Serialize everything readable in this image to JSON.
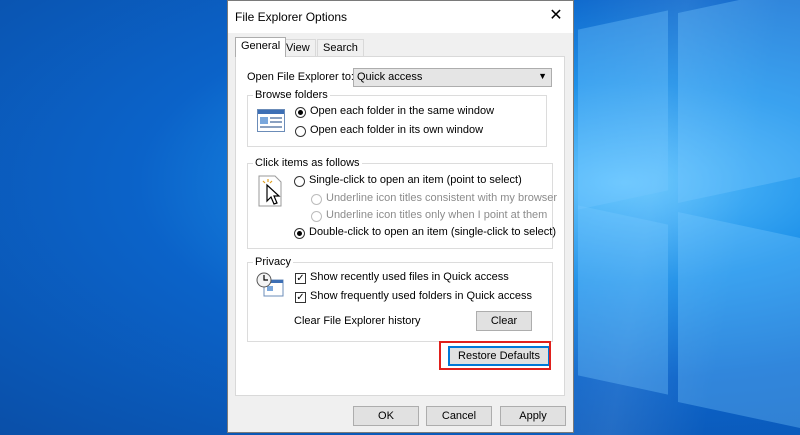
{
  "dialog": {
    "title": "File Explorer Options",
    "close_glyph": "✕"
  },
  "tabs": [
    {
      "label": "General"
    },
    {
      "label": "View"
    },
    {
      "label": "Search"
    }
  ],
  "general": {
    "open_to_label": "Open File Explorer to:",
    "open_to_value": "Quick access",
    "browse_folders": {
      "legend": "Browse folders",
      "same_window": "Open each folder in the same window",
      "own_window": "Open each folder in its own window"
    },
    "click_items": {
      "legend": "Click items as follows",
      "single_click": "Single-click to open an item (point to select)",
      "underline_consistent": "Underline icon titles consistent with my browser",
      "underline_point": "Underline icon titles only when I point at them",
      "double_click": "Double-click to open an item (single-click to select)"
    },
    "privacy": {
      "legend": "Privacy",
      "recent_files": "Show recently used files in Quick access",
      "frequent_folders": "Show frequently used folders in Quick access",
      "clear_history_label": "Clear File Explorer history",
      "clear_button": "Clear"
    },
    "restore_defaults": "Restore Defaults"
  },
  "footer": {
    "ok": "OK",
    "cancel": "Cancel",
    "apply": "Apply"
  },
  "colors": {
    "highlight": "#e0201c",
    "desktop_blue": "#0b63c9"
  }
}
